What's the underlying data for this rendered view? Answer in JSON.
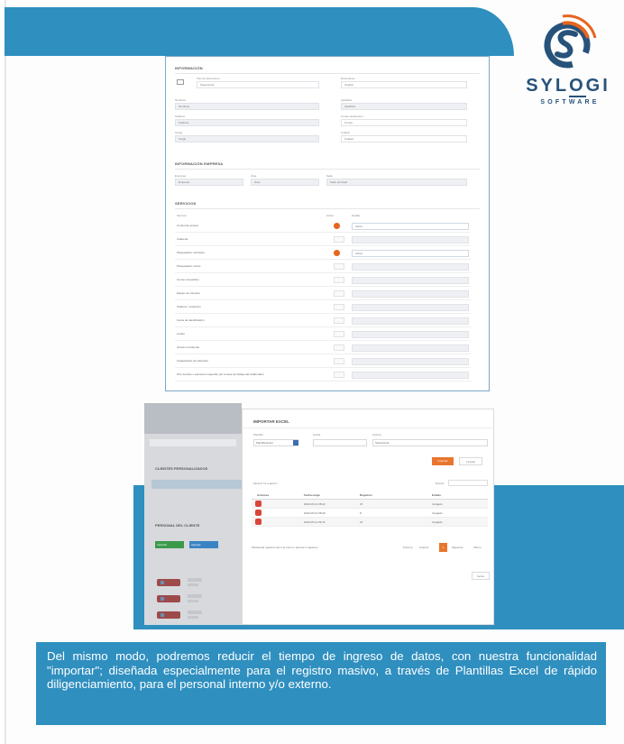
{
  "brand": {
    "name_letters": [
      "SYL",
      "O",
      "GI"
    ],
    "sub": "SOFTWARE",
    "colors": {
      "navy": "#27527a",
      "orange": "#e8641f",
      "blue": "#2f8fbf"
    }
  },
  "form": {
    "sections": {
      "general": "INFORMACIÓN",
      "company": "INFORMACIÓN EMPRESA",
      "services": "SERVICIOS"
    },
    "fields": {
      "tipo_doc": "Tipo de documento",
      "tipo_doc_value": "Seleccionar",
      "documento": "Documento",
      "documento_value": "Cédula",
      "nombres": "Nombres",
      "nombres_value": "Nombres",
      "apellidos": "Apellidos",
      "apellidos_value": "Apellidos",
      "telefono": "Teléfono",
      "telefono_value": "Teléfono",
      "correo": "Correo electrónico",
      "correo_value": "Correo",
      "cargo": "Cargo",
      "cargo_value": "Cargo",
      "ciudad": "Ciudad",
      "ciudad_value": "Ciudad",
      "empresa": "Empresa",
      "empresa_value": "Empresa",
      "area": "Área",
      "area_value": "Área",
      "sede": "Sede",
      "sede_value": "Sede principal"
    },
    "services_headers": {
      "service": "Servicio",
      "active": "Activo",
      "detail": "Detalle"
    },
    "services": [
      {
        "name": "Control de acceso",
        "on": true,
        "value": "Activo",
        "highlight": true
      },
      {
        "name": "Cafetería",
        "on": false,
        "value": "",
        "highlight": false
      },
      {
        "name": "Parqueadero vehículos",
        "on": true,
        "value": "Activo",
        "highlight": true
      },
      {
        "name": "Parqueadero motos",
        "on": false,
        "value": "",
        "highlight": false
      },
      {
        "name": "Correo corporativo",
        "on": false,
        "value": "",
        "highlight": false
      },
      {
        "name": "Equipo de cómputo",
        "on": false,
        "value": "",
        "highlight": false
      },
      {
        "name": "Teléfono / extensión",
        "on": false,
        "value": "",
        "highlight": false
      },
      {
        "name": "Carné de identificación",
        "on": false,
        "value": "",
        "highlight": false
      },
      {
        "name": "Locker",
        "on": false,
        "value": "",
        "highlight": false
      },
      {
        "name": "Acceso a sistemas",
        "on": false,
        "value": "",
        "highlight": false
      },
      {
        "name": "Capacitación de inducción",
        "on": false,
        "value": "",
        "highlight": false
      },
      {
        "name": "Otro servicio o elemento requerido por el área de trabajo del colaborador",
        "on": false,
        "value": "",
        "highlight": false
      }
    ]
  },
  "background_app": {
    "title1": "CLIENTES PERSONALIZADOS",
    "title2": "PERSONAL DEL CLIENTE",
    "btn1": "Importar",
    "btn2": "Agregar"
  },
  "modal": {
    "title": "IMPORTAR EXCEL",
    "labels": {
      "template": "Plantilla",
      "date": "Fecha",
      "file": "Archivo"
    },
    "values": {
      "template": "Plantilla Excel",
      "date": "",
      "file": "Seleccionar"
    },
    "import_btn": "Importar",
    "clean_btn": "Limpiar",
    "show_label": "Mostrar 10 registros",
    "search_label": "Buscar:",
    "columns": [
      "Acciones",
      "Fecha carga",
      "Registros",
      "Estado"
    ],
    "rows": [
      {
        "date": "2022-05-10 08:22",
        "count": "15",
        "status": "Cargado"
      },
      {
        "date": "2022-05-10 08:40",
        "count": "8",
        "status": "Cargado"
      },
      {
        "date": "2022-05-11 09:15",
        "count": "22",
        "status": "Cargado"
      }
    ],
    "footer_info": "Mostrando registros del 1 al 3 de un total de 3 registros",
    "pager": {
      "first": "Primero",
      "prev": "Anterior",
      "current": "1",
      "next": "Siguiente",
      "last": "Último"
    },
    "close_btn": "Cerrar"
  },
  "caption": "Del mismo modo, podremos reducir el tiempo de ingreso de datos, con nuestra funcionalidad \"importar\"; diseñada especialmente para el registro masivo, a través de Plantillas Excel de rápido diligenciamiento, para el personal interno y/o externo."
}
